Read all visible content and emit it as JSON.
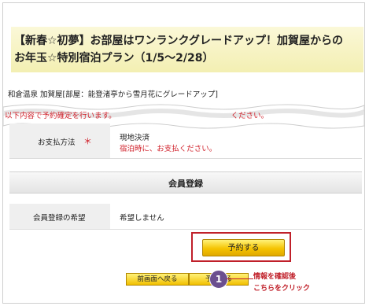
{
  "plan": {
    "title_line1": "【新春☆初夢】お部屋はワンランクグレードアップ！加賀屋からの",
    "title_line2": "お年玉☆特別宿泊プラン（1/5〜2/28）"
  },
  "hotel_line": "和倉温泉 加賀屋[部屋：能登渚亭から雪月花にグレードアップ]",
  "notice_partial": "以下内容で予約確定を行います。",
  "notice_partial_tail": "ください。",
  "payment": {
    "label": "お支払方法",
    "required_mark": "＊",
    "value": "現地決済",
    "note": "宿泊時に、お支払ください。"
  },
  "member": {
    "section_title": "会員登録",
    "label": "会員登録の希望",
    "value": "希望しません"
  },
  "buttons": {
    "reserve": "予約する",
    "back": "前画面へ戻る",
    "reserve_small": "予約する"
  },
  "annotation": {
    "step": "1",
    "line1": "情報を確認後",
    "line2": "こちらをクリック"
  },
  "colors": {
    "accent_red": "#c0202a",
    "button_yellow": "#f5c400",
    "badge_purple": "#6b4f8f"
  }
}
